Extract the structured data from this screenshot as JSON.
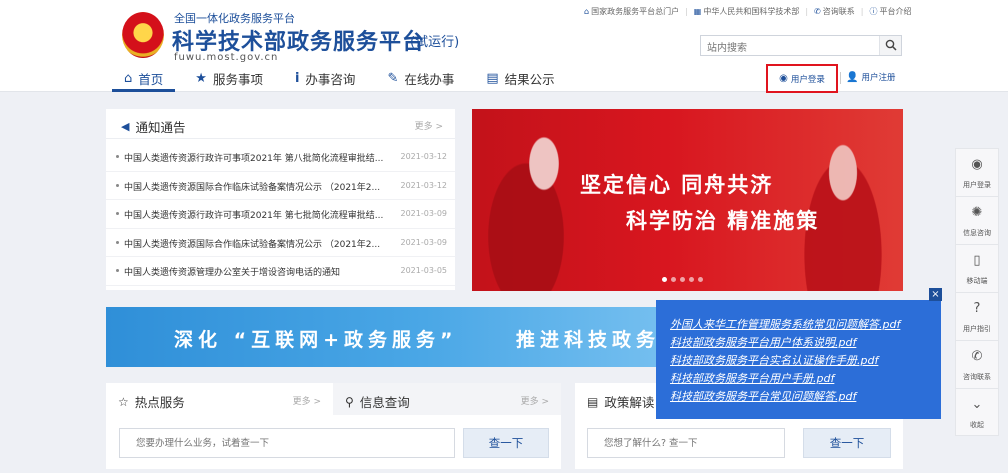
{
  "header": {
    "subtitle": "全国一体化政务服务平台",
    "title": "科学技术部政务服务平台",
    "trial": "(试运行)",
    "domain": "fuwu.most.gov.cn",
    "top_links": [
      "国家政务服务平台总门户",
      "中华人民共和国科学技术部",
      "咨询联系",
      "平台介绍"
    ],
    "search_placeholder": "站内搜索"
  },
  "nav": {
    "items": [
      {
        "label": "首页",
        "icon": "home-icon",
        "active": true
      },
      {
        "label": "服务事项",
        "icon": "star-icon"
      },
      {
        "label": "办事咨询",
        "icon": "info-icon"
      },
      {
        "label": "在线办事",
        "icon": "pencil-icon"
      },
      {
        "label": "结果公示",
        "icon": "document-icon"
      }
    ],
    "login": "用户登录",
    "register": "用户注册"
  },
  "notice": {
    "title": "通知通告",
    "more": "更多 >",
    "items": [
      {
        "text": "中国人类遗传资源行政许可事项2021年 第八批简化流程审批结...",
        "date": "2021-03-12"
      },
      {
        "text": "中国人类遗传资源国际合作临床试验备案情况公示 （2021年2...",
        "date": "2021-03-12"
      },
      {
        "text": "中国人类遗传资源行政许可事项2021年 第七批简化流程审批结...",
        "date": "2021-03-09"
      },
      {
        "text": "中国人类遗传资源国际合作临床试验备案情况公示 （2021年2...",
        "date": "2021-03-09"
      },
      {
        "text": "中国人类遗传资源管理办公室关于增设咨询电话的通知",
        "date": "2021-03-05"
      }
    ]
  },
  "banner": {
    "line1": "坚定信心  同舟共济",
    "line2": "科学防治  精准施策",
    "slide_count": 5,
    "active_slide": 1
  },
  "strip": {
    "left": "深化 “互联网+政务服务”",
    "right": "推进科技政务"
  },
  "services": {
    "tab1": "热点服务",
    "tab1_more": "更多 >",
    "tab2": "信息查询",
    "tab2_more": "更多 >",
    "placeholder": "您要办理什么业务，试着查一下",
    "button": "查一下"
  },
  "policy": {
    "title": "政策解读",
    "placeholder": "您想了解什么? 查一下",
    "button": "查一下"
  },
  "popup": {
    "close": "×",
    "links": [
      "外国人来华工作管理服务系统常见问题解答.pdf",
      "科技部政务服务平台用户体系说明.pdf",
      "科技部政务服务平台实名认证操作手册.pdf",
      "科技部政务服务平台用户手册.pdf",
      "科技部政务服务平台常见问题解答.pdf"
    ]
  },
  "sidebar": {
    "items": [
      {
        "label": "用户登录",
        "icon": "user-icon"
      },
      {
        "label": "信息咨询",
        "icon": "bulb-icon"
      },
      {
        "label": "移动端",
        "icon": "mobile-icon"
      },
      {
        "label": "用户指引",
        "icon": "help-icon"
      },
      {
        "label": "咨询联系",
        "icon": "phone-icon"
      },
      {
        "label": "收起",
        "icon": "chevron-down-icon"
      }
    ]
  }
}
